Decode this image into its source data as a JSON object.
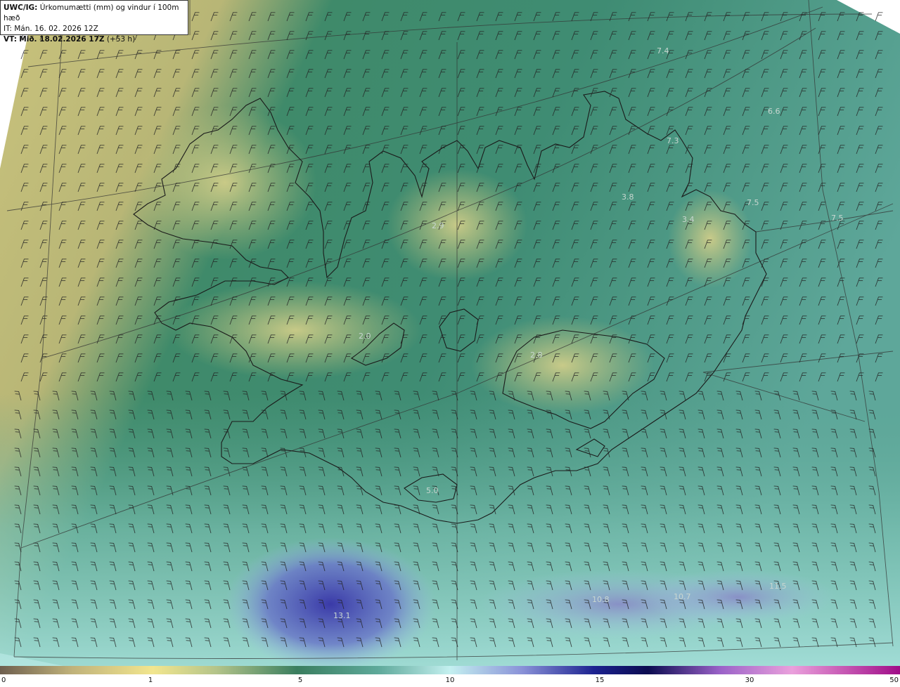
{
  "header": {
    "product": "UWC/IG:",
    "title": "Úrkomumætti (mm) og vindur í 100m hæð",
    "init_label": "IT:",
    "init_time": "Mán. 16. 02. 2026 12Z",
    "valid_label": "VT:",
    "valid_time": "Mið. 18.02.2026 17Z",
    "lead": "(+53 h)"
  },
  "colorbar": {
    "ticks": [
      "0",
      "1",
      "5",
      "10",
      "15",
      "30",
      "50"
    ],
    "colors": [
      "#7a6a55",
      "#c9c07a",
      "#f1e58c",
      "#d8dc8c",
      "#5f9a74",
      "#2e7a5c",
      "#5fa99a",
      "#bfeef0",
      "#8a9ad8",
      "#2b2fa0",
      "#0a0a55",
      "#b06ad0",
      "#e890d8",
      "#b0108f"
    ]
  },
  "values": [
    {
      "text": "7.4"
    },
    {
      "text": "6.6"
    },
    {
      "text": "7.3"
    },
    {
      "text": "3.8"
    },
    {
      "text": "7.5"
    },
    {
      "text": "7.5"
    },
    {
      "text": "3.4"
    },
    {
      "text": "2.9"
    },
    {
      "text": "2.8"
    },
    {
      "text": "2.0"
    },
    {
      "text": "5.0"
    },
    {
      "text": "13.1"
    },
    {
      "text": "10.8"
    },
    {
      "text": "10.7"
    },
    {
      "text": "11.5"
    }
  ]
}
